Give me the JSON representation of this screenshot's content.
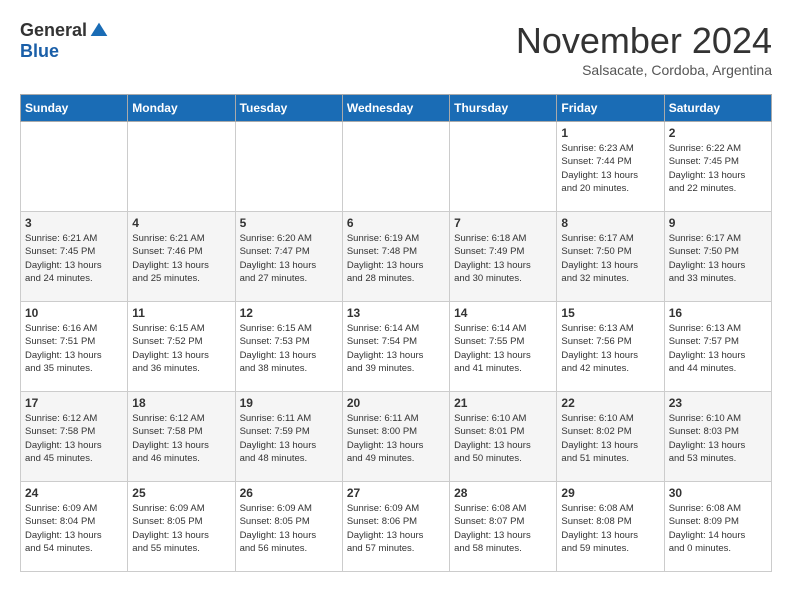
{
  "header": {
    "logo_general": "General",
    "logo_blue": "Blue",
    "month": "November 2024",
    "location": "Salsacate, Cordoba, Argentina"
  },
  "days_of_week": [
    "Sunday",
    "Monday",
    "Tuesday",
    "Wednesday",
    "Thursday",
    "Friday",
    "Saturday"
  ],
  "weeks": [
    [
      {
        "day": "",
        "info": ""
      },
      {
        "day": "",
        "info": ""
      },
      {
        "day": "",
        "info": ""
      },
      {
        "day": "",
        "info": ""
      },
      {
        "day": "",
        "info": ""
      },
      {
        "day": "1",
        "info": "Sunrise: 6:23 AM\nSunset: 7:44 PM\nDaylight: 13 hours\nand 20 minutes."
      },
      {
        "day": "2",
        "info": "Sunrise: 6:22 AM\nSunset: 7:45 PM\nDaylight: 13 hours\nand 22 minutes."
      }
    ],
    [
      {
        "day": "3",
        "info": "Sunrise: 6:21 AM\nSunset: 7:45 PM\nDaylight: 13 hours\nand 24 minutes."
      },
      {
        "day": "4",
        "info": "Sunrise: 6:21 AM\nSunset: 7:46 PM\nDaylight: 13 hours\nand 25 minutes."
      },
      {
        "day": "5",
        "info": "Sunrise: 6:20 AM\nSunset: 7:47 PM\nDaylight: 13 hours\nand 27 minutes."
      },
      {
        "day": "6",
        "info": "Sunrise: 6:19 AM\nSunset: 7:48 PM\nDaylight: 13 hours\nand 28 minutes."
      },
      {
        "day": "7",
        "info": "Sunrise: 6:18 AM\nSunset: 7:49 PM\nDaylight: 13 hours\nand 30 minutes."
      },
      {
        "day": "8",
        "info": "Sunrise: 6:17 AM\nSunset: 7:50 PM\nDaylight: 13 hours\nand 32 minutes."
      },
      {
        "day": "9",
        "info": "Sunrise: 6:17 AM\nSunset: 7:50 PM\nDaylight: 13 hours\nand 33 minutes."
      }
    ],
    [
      {
        "day": "10",
        "info": "Sunrise: 6:16 AM\nSunset: 7:51 PM\nDaylight: 13 hours\nand 35 minutes."
      },
      {
        "day": "11",
        "info": "Sunrise: 6:15 AM\nSunset: 7:52 PM\nDaylight: 13 hours\nand 36 minutes."
      },
      {
        "day": "12",
        "info": "Sunrise: 6:15 AM\nSunset: 7:53 PM\nDaylight: 13 hours\nand 38 minutes."
      },
      {
        "day": "13",
        "info": "Sunrise: 6:14 AM\nSunset: 7:54 PM\nDaylight: 13 hours\nand 39 minutes."
      },
      {
        "day": "14",
        "info": "Sunrise: 6:14 AM\nSunset: 7:55 PM\nDaylight: 13 hours\nand 41 minutes."
      },
      {
        "day": "15",
        "info": "Sunrise: 6:13 AM\nSunset: 7:56 PM\nDaylight: 13 hours\nand 42 minutes."
      },
      {
        "day": "16",
        "info": "Sunrise: 6:13 AM\nSunset: 7:57 PM\nDaylight: 13 hours\nand 44 minutes."
      }
    ],
    [
      {
        "day": "17",
        "info": "Sunrise: 6:12 AM\nSunset: 7:58 PM\nDaylight: 13 hours\nand 45 minutes."
      },
      {
        "day": "18",
        "info": "Sunrise: 6:12 AM\nSunset: 7:58 PM\nDaylight: 13 hours\nand 46 minutes."
      },
      {
        "day": "19",
        "info": "Sunrise: 6:11 AM\nSunset: 7:59 PM\nDaylight: 13 hours\nand 48 minutes."
      },
      {
        "day": "20",
        "info": "Sunrise: 6:11 AM\nSunset: 8:00 PM\nDaylight: 13 hours\nand 49 minutes."
      },
      {
        "day": "21",
        "info": "Sunrise: 6:10 AM\nSunset: 8:01 PM\nDaylight: 13 hours\nand 50 minutes."
      },
      {
        "day": "22",
        "info": "Sunrise: 6:10 AM\nSunset: 8:02 PM\nDaylight: 13 hours\nand 51 minutes."
      },
      {
        "day": "23",
        "info": "Sunrise: 6:10 AM\nSunset: 8:03 PM\nDaylight: 13 hours\nand 53 minutes."
      }
    ],
    [
      {
        "day": "24",
        "info": "Sunrise: 6:09 AM\nSunset: 8:04 PM\nDaylight: 13 hours\nand 54 minutes."
      },
      {
        "day": "25",
        "info": "Sunrise: 6:09 AM\nSunset: 8:05 PM\nDaylight: 13 hours\nand 55 minutes."
      },
      {
        "day": "26",
        "info": "Sunrise: 6:09 AM\nSunset: 8:05 PM\nDaylight: 13 hours\nand 56 minutes."
      },
      {
        "day": "27",
        "info": "Sunrise: 6:09 AM\nSunset: 8:06 PM\nDaylight: 13 hours\nand 57 minutes."
      },
      {
        "day": "28",
        "info": "Sunrise: 6:08 AM\nSunset: 8:07 PM\nDaylight: 13 hours\nand 58 minutes."
      },
      {
        "day": "29",
        "info": "Sunrise: 6:08 AM\nSunset: 8:08 PM\nDaylight: 13 hours\nand 59 minutes."
      },
      {
        "day": "30",
        "info": "Sunrise: 6:08 AM\nSunset: 8:09 PM\nDaylight: 14 hours\nand 0 minutes."
      }
    ]
  ]
}
